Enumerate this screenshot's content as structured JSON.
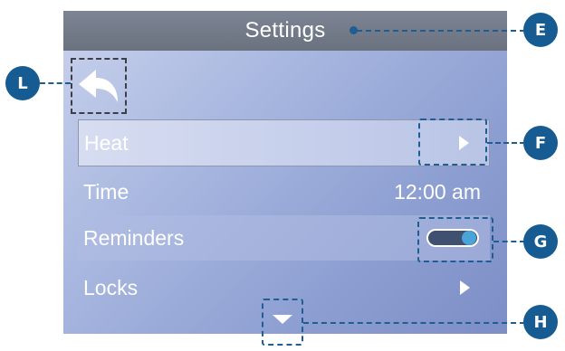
{
  "header": {
    "title": "Settings"
  },
  "menu": {
    "heat": {
      "label": "Heat"
    },
    "time": {
      "label": "Time",
      "value": "12:00 am"
    },
    "reminders": {
      "label": "Reminders",
      "toggle_on": true
    },
    "locks": {
      "label": "Locks"
    }
  },
  "icons": {
    "back": "back-arrow-icon",
    "submenu": "chevron-right-icon",
    "scroll_down": "chevron-down-icon"
  },
  "callouts": {
    "e": "E",
    "f": "F",
    "g": "G",
    "h": "H",
    "l": "L"
  },
  "colors": {
    "callout": "#165c93",
    "header_bg": "#6f7786",
    "toggle_knob": "#4aa3d9"
  }
}
